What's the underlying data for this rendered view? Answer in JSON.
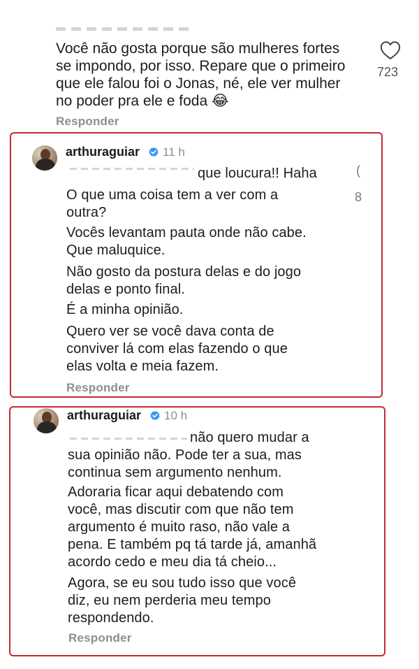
{
  "comment_top": {
    "text": "Você não gosta porque são mulheres fortes\nse impondo, por isso. Repare que o primeiro\nque ele falou foi o Jonas, né, ele ver mulher\nno poder pra ele e foda 😂",
    "reply_label": "Responder",
    "like_count": "723",
    "icon": "heart-icon"
  },
  "reply1": {
    "username": "arthuraguiar",
    "time": "11 h",
    "first_line": "que loucura!! Haha",
    "paragraphs": [
      "O que uma coisa tem a ver com a\noutra?",
      "Vocês levantam pauta onde não cabe.\nQue maluquice.",
      "Não gosto da postura delas e do jogo\ndelas e ponto final.",
      "É a minha opinião.",
      "Quero ver se você dava conta de\nconviver lá com elas fazendo o que\nelas volta e meia fazem."
    ],
    "reply_label": "Responder",
    "side_cut_icon": "(",
    "side_cut_count": "8"
  },
  "reply2": {
    "username": "arthuraguiar",
    "time": "10 h",
    "paragraphs": [
      "não quero mudar a\nsua opinião não. Pode ter a sua, mas\ncontinua sem argumento nenhum.",
      "Adoraria ficar aqui debatendo com\nvocê, mas discutir com que não tem\nargumento é muito raso, não vale a\npena. E também pq tá tarde já, amanhã\nacordo cedo e meu dia tá cheio...",
      "Agora, se eu sou tudo isso que você\ndiz, eu nem perderia meu tempo\nrespondendo."
    ],
    "reply_label": "Responder"
  },
  "colors": {
    "highlight_border": "#c42a36",
    "muted_text": "#8e8e8e",
    "verified_blue": "#3897f0"
  }
}
